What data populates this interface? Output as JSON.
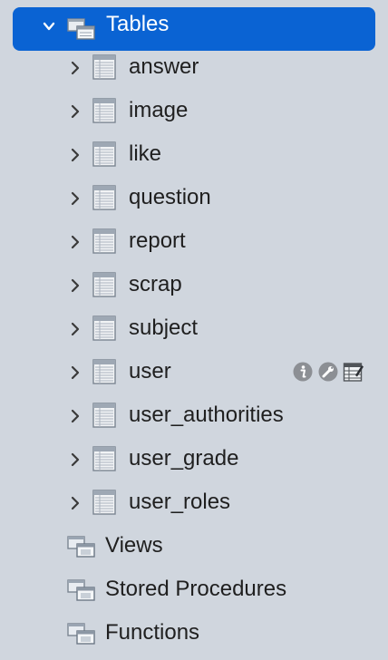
{
  "tree": {
    "root": {
      "label": "Tables",
      "icon": "tables-group-icon",
      "expanded": true,
      "accent_color": "#0a63d3"
    },
    "tables": [
      {
        "name": "answer"
      },
      {
        "name": "image"
      },
      {
        "name": "like"
      },
      {
        "name": "question"
      },
      {
        "name": "report"
      },
      {
        "name": "scrap"
      },
      {
        "name": "subject"
      },
      {
        "name": "user",
        "hovered": true
      },
      {
        "name": "user_authorities"
      },
      {
        "name": "user_grade"
      },
      {
        "name": "user_roles"
      }
    ],
    "groups": [
      {
        "label": "Views",
        "icon": "views-group-icon"
      },
      {
        "label": "Stored Procedures",
        "icon": "procedures-group-icon"
      },
      {
        "label": "Functions",
        "icon": "functions-group-icon"
      }
    ],
    "row_actions": [
      "info-icon",
      "wrench-icon",
      "edit-table-icon"
    ]
  }
}
